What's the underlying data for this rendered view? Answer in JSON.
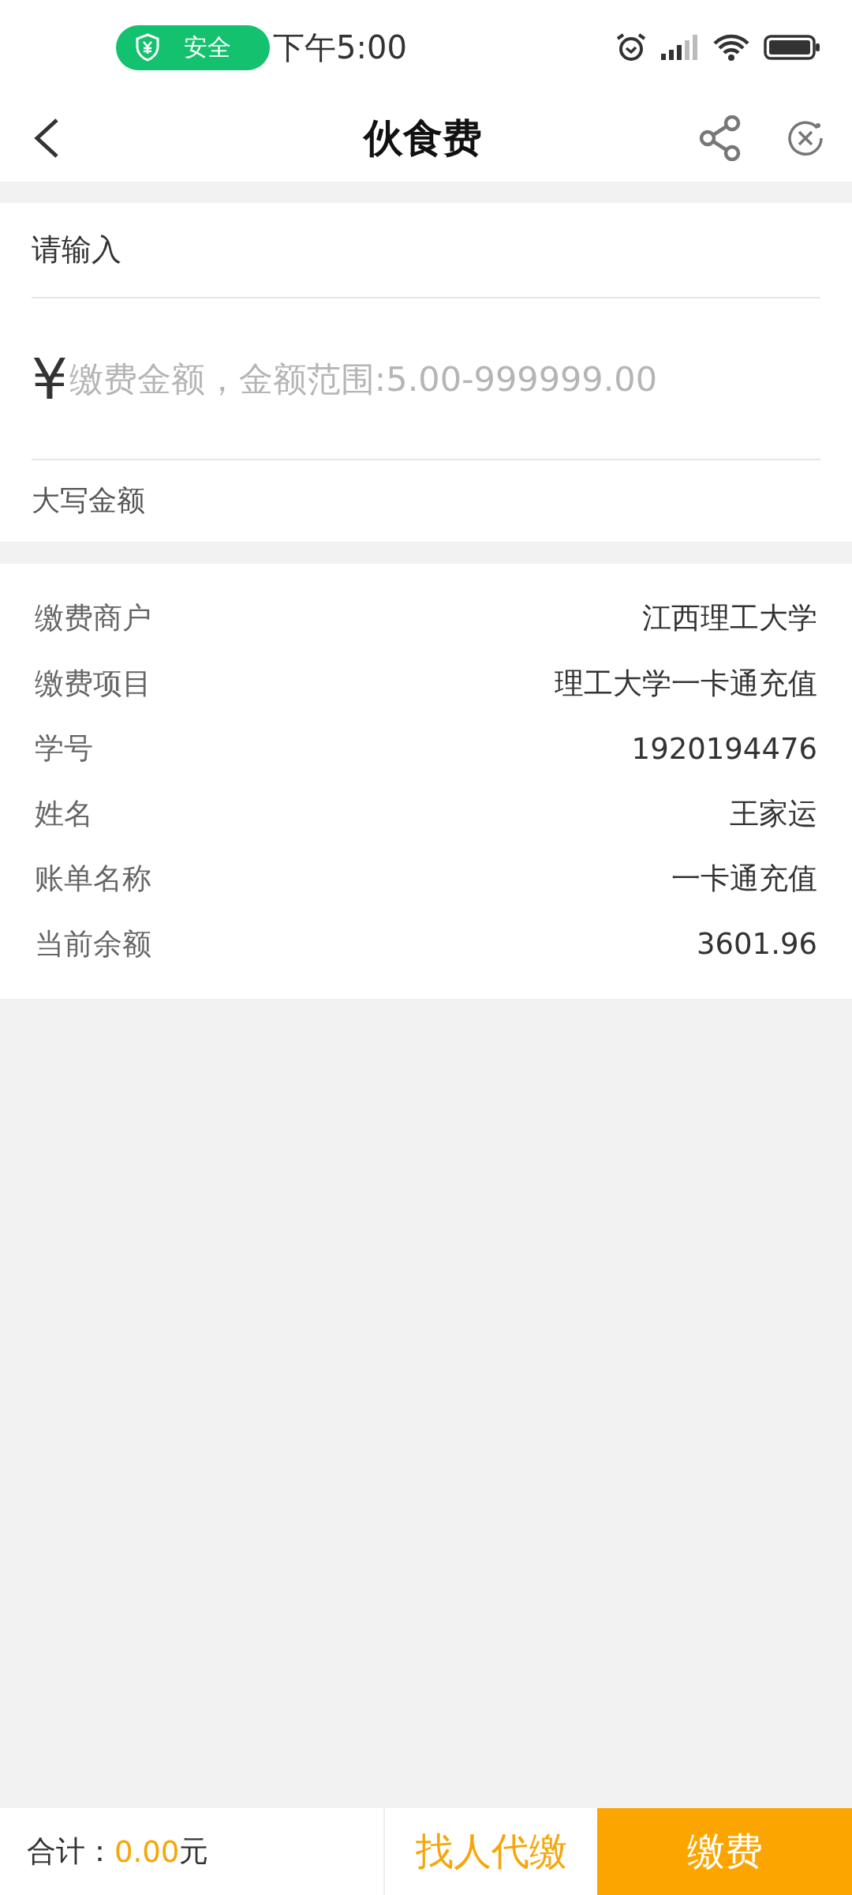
{
  "status_bar": {
    "badge": "安全",
    "time": "下午5:00"
  },
  "nav": {
    "title": "伙食费"
  },
  "input_section": {
    "label": "请输入",
    "currency": "¥",
    "amount_placeholder": "缴费金额，金额范围:5.00-999999.00",
    "uppercase_label": "大写金额"
  },
  "details": [
    {
      "label": "缴费商户",
      "value": "江西理工大学"
    },
    {
      "label": "缴费项目",
      "value": "理工大学一卡通充值"
    },
    {
      "label": "学号",
      "value": "1920194476"
    },
    {
      "label": "姓名",
      "value": "王家运"
    },
    {
      "label": "账单名称",
      "value": "一卡通充值"
    },
    {
      "label": "当前余额",
      "value": "3601.96"
    }
  ],
  "footer": {
    "total_label": "合计：",
    "total_amount": "0.00",
    "total_unit": "元",
    "proxy_button": "找人代缴",
    "pay_button": "缴费"
  }
}
